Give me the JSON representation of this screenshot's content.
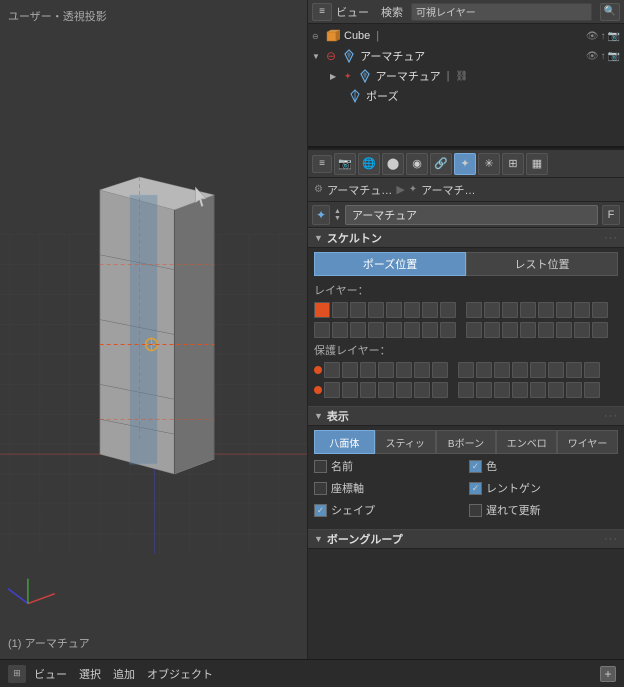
{
  "viewport": {
    "label": "ユーザー・透視投影",
    "armature_label": "(1) アーマチュア",
    "cursor_char": "⬉"
  },
  "outliner": {
    "header": {
      "view_label": "ビュー",
      "search_label": "検索",
      "layer_label": "可視レイヤー"
    },
    "items": [
      {
        "name": "Cube",
        "type": "cube",
        "indent": 0,
        "expanded": false
      },
      {
        "name": "アーマチュア",
        "type": "armature",
        "indent": 0,
        "expanded": true
      },
      {
        "name": "アーマチュア",
        "type": "armature-sub",
        "indent": 1,
        "expanded": false
      },
      {
        "name": "ポーズ",
        "type": "pose",
        "indent": 2,
        "expanded": false
      }
    ]
  },
  "properties": {
    "breadcrumb": {
      "icon1": "⚙",
      "item1": "アーマチュ…",
      "sep": "▶",
      "icon2": "✦",
      "item2": "アーマチ…"
    },
    "datablock": {
      "name": "アーマチュア",
      "f_label": "F"
    },
    "sections": {
      "skeleton": {
        "title": "スケルトン",
        "pose_btn": "ポーズ位置",
        "rest_btn": "レスト位置",
        "layer_label": "レイヤー：",
        "protect_label": "保護レイヤー："
      },
      "display": {
        "title": "表示",
        "tabs": [
          "八面体",
          "スティッ",
          "Bボーン",
          "エンベロ",
          "ワイヤー"
        ],
        "checks": [
          {
            "label": "名前",
            "checked": false
          },
          {
            "label": "色",
            "checked": true
          },
          {
            "label": "座標軸",
            "checked": false
          },
          {
            "label": "レントゲン",
            "checked": true
          },
          {
            "label": "シェイプ",
            "checked": true
          },
          {
            "label": "遅れて更新",
            "checked": false
          }
        ]
      },
      "bone_group": {
        "title": "ボーングループ"
      }
    }
  },
  "toolbar_icons": [
    "⊞",
    "🖼",
    "🔲",
    "🌐",
    "🔗",
    "✦",
    "🔑",
    "🎯",
    "▦"
  ],
  "status_bar": {
    "left_items": [
      "ビュー",
      "選択",
      "追加",
      "オブジェクト"
    ],
    "right_items": []
  }
}
